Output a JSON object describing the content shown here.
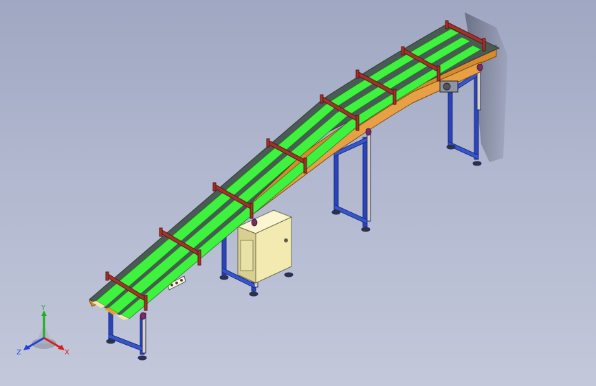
{
  "viewport": {
    "background_top": "#9fa7c2",
    "background_bottom": "#c3c8da"
  },
  "model": {
    "belt_color": "#3ff23f",
    "frame_color": "#d98a2a",
    "leg_color": "#2b44b8",
    "guard_color": "#a0342c",
    "cabinet_color": "#f2eab0"
  },
  "triad": {
    "x_label": "X",
    "y_label": "Y",
    "z_label": "Z",
    "x_color": "#d42020",
    "y_color": "#1fae1f",
    "z_color": "#2040d8"
  }
}
